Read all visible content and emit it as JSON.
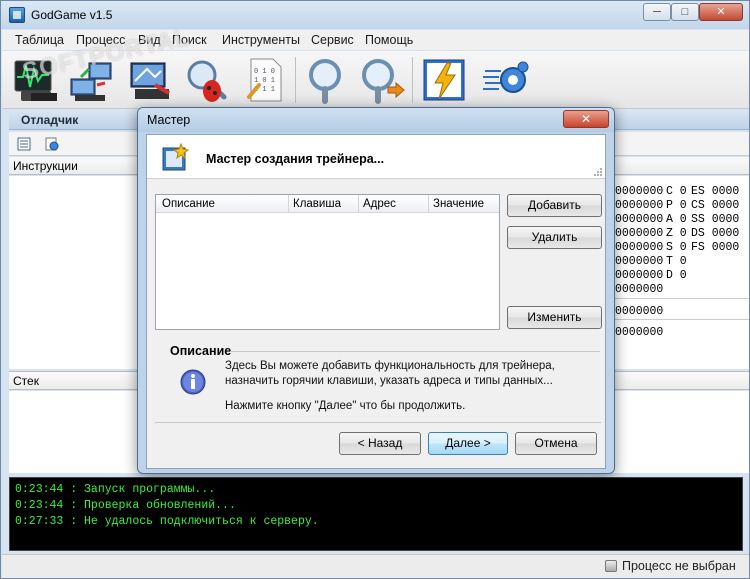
{
  "app": {
    "title": "GodGame v1.5",
    "window_controls": {
      "minimize": "─",
      "maximize": "□",
      "close": "✕"
    }
  },
  "menu": [
    "Таблица",
    "Процесс",
    "Вид",
    "Поиск",
    "Инструменты",
    "Сервис",
    "Помощь"
  ],
  "toolbar": {
    "buttons": [
      "waveform-monitor-icon",
      "network-connect-icon",
      "process-list-icon",
      "debug-bug-icon",
      "binary-file-icon",
      "search-magnifier-icon",
      "search-next-icon",
      "trainer-lightning-icon",
      "settings-gears-icon"
    ]
  },
  "watermark": "SOFTPORTAL",
  "debugger": {
    "panel_title": "Отладчик",
    "instructions_label": "Инструкции",
    "stack_label": "Стек",
    "registers": {
      "values": [
        "0000000",
        "0000000",
        "0000000",
        "0000000",
        "0000000",
        "0000000",
        "0000000",
        "0000000"
      ],
      "flags": [
        "C 0",
        "P 0",
        "A 0",
        "Z 0",
        "S 0",
        "T 0",
        "D 0"
      ],
      "segments": [
        "ES 0000",
        "CS 0000",
        "SS 0000",
        "DS 0000",
        "FS 0000"
      ],
      "extra_values": [
        "0000000",
        "0000000"
      ]
    }
  },
  "log": [
    {
      "time": "0:23:44",
      "text": " : Запуск программы..."
    },
    {
      "time": "0:23:44",
      "text": " : Проверка обновлений..."
    },
    {
      "time": "0:27:33",
      "text": " : Не удалось подключиться к серверу."
    }
  ],
  "status": {
    "text": "Процесс не выбран"
  },
  "dialog": {
    "title": "Мастер",
    "close": "✕",
    "header": "Мастер создания трейнера...",
    "columns": [
      "Описание",
      "Клавиша",
      "Адрес",
      "Значение"
    ],
    "buttons": {
      "add": "Добавить",
      "remove": "Удалить",
      "edit": "Изменить",
      "back": "< Назад",
      "next": "Далее >",
      "cancel": "Отмена"
    },
    "description_title": "Описание",
    "description_lines": [
      "Здесь Вы можете добавить функциональность для трейнера,",
      "назначить горячии клавиши, указать адреса и типы данных...",
      "Нажмите кнопку \"Далее\" что бы продолжить."
    ]
  },
  "colors": {
    "log_text": "#3cf03c",
    "log_bg": "#000000",
    "accent_blue": "#3c7fb1"
  }
}
